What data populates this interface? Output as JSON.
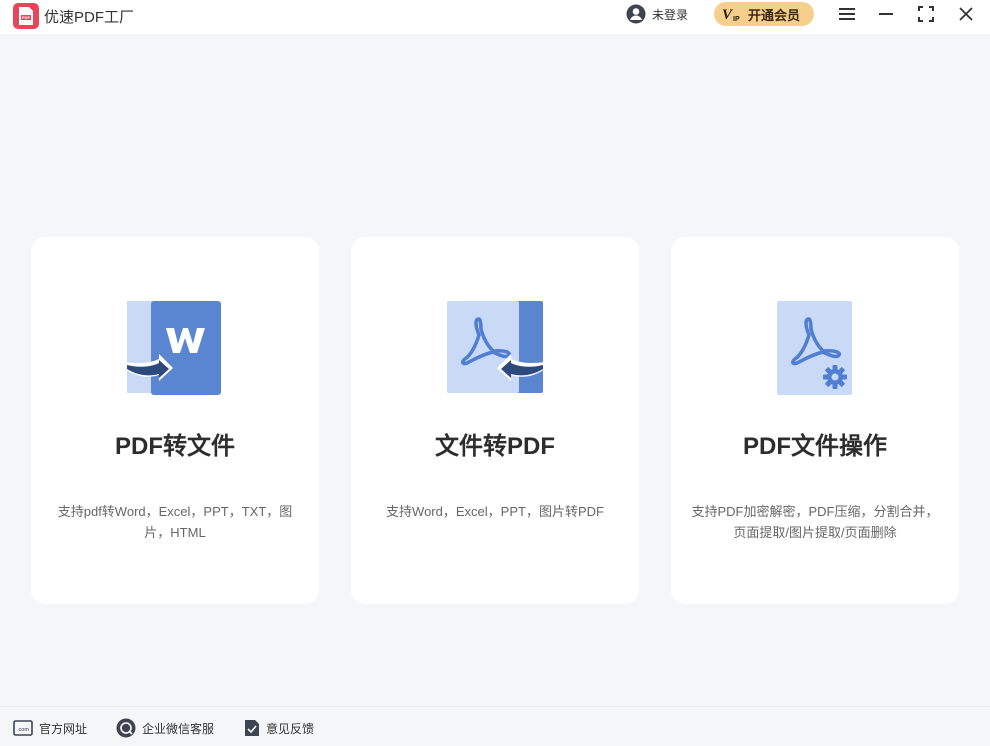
{
  "app": {
    "title": "优速PDF工厂",
    "logo_icon": "pdf-app-logo",
    "accent_color": "#e8445a"
  },
  "header": {
    "login_label": "未登录",
    "vip_label": "开通会员",
    "vip_color": "#f5cf8b"
  },
  "cards": [
    {
      "title": "PDF转文件",
      "description": "支持pdf转Word，Excel，PPT，TXT，图片，HTML",
      "icon": "pdf-to-word-icon"
    },
    {
      "title": "文件转PDF",
      "description": "支持Word，Excel，PPT，图片转PDF",
      "icon": "file-to-pdf-icon"
    },
    {
      "title": "PDF文件操作",
      "description": "支持PDF加密解密，PDF压缩，分割合并，页面提取/图片提取/页面删除",
      "icon": "pdf-operations-icon"
    }
  ],
  "footer": {
    "website_label": "官方网址",
    "wechat_label": "企业微信客服",
    "feedback_label": "意见反馈"
  },
  "colors": {
    "icon_dark_blue": "#4f7ed3",
    "icon_light_blue": "#c9daf6",
    "background": "#f5f6f8"
  }
}
